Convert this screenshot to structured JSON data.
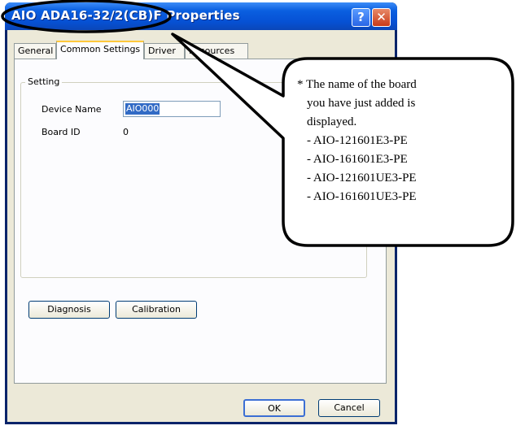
{
  "window": {
    "title": "AIO ADA16-32/2(CB)F Properties",
    "help_symbol": "?",
    "close_symbol": "✕"
  },
  "tabs": [
    {
      "label": "General",
      "active": false
    },
    {
      "label": "Common Settings",
      "active": true
    },
    {
      "label": "Driver",
      "active": false
    },
    {
      "label": "Resources",
      "active": false
    }
  ],
  "setting_group": {
    "label": "Setting",
    "device_name_label": "Device Name",
    "device_name_value": "AIO000",
    "board_id_label": "Board ID",
    "board_id_value": "0"
  },
  "buttons": {
    "diagnosis": "Diagnosis",
    "calibration": "Calibration",
    "ok": "OK",
    "cancel": "Cancel"
  },
  "callout": {
    "lines": [
      "* The name of the board",
      "you have just added is",
      "displayed.",
      "- AIO-121601E3-PE",
      "- AIO-161601E3-PE",
      "- AIO-121601UE3-PE",
      "- AIO-161601UE3-PE"
    ]
  }
}
